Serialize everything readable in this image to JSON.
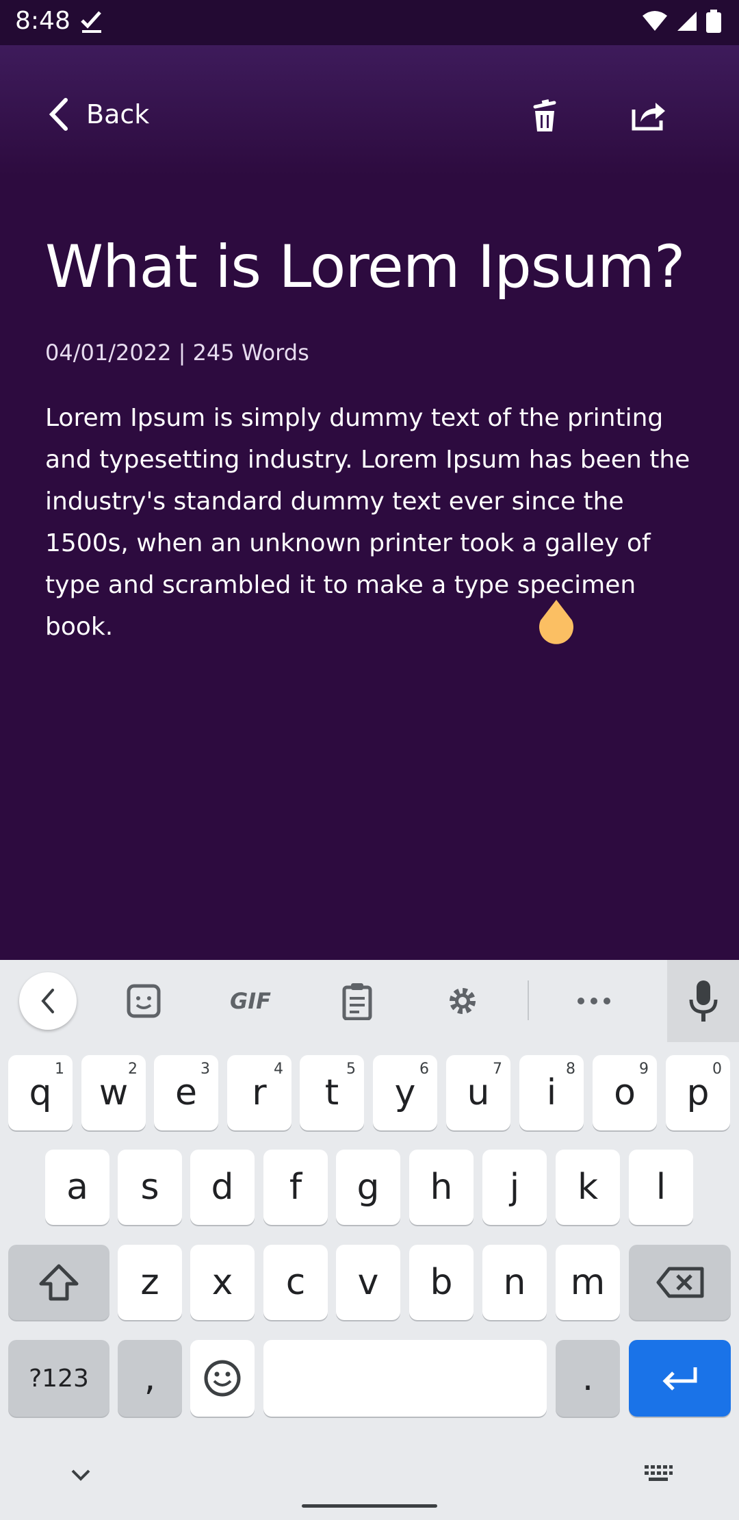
{
  "status": {
    "time": "8:48"
  },
  "header": {
    "back_label": "Back"
  },
  "note": {
    "title": "What is Lorem Ipsum?",
    "meta": "04/01/2022 | 245 Words",
    "body": "Lorem Ipsum is simply dummy text of the printing and typesetting industry. Lorem Ipsum has been the industry's standard dummy text ever since the 1500s, when an unknown printer took a galley of type and scrambled it to make a type specimen book."
  },
  "keyboard": {
    "toolbar": {
      "gif_label": "GIF"
    },
    "row1": [
      {
        "k": "q",
        "h": "1"
      },
      {
        "k": "w",
        "h": "2"
      },
      {
        "k": "e",
        "h": "3"
      },
      {
        "k": "r",
        "h": "4"
      },
      {
        "k": "t",
        "h": "5"
      },
      {
        "k": "y",
        "h": "6"
      },
      {
        "k": "u",
        "h": "7"
      },
      {
        "k": "i",
        "h": "8"
      },
      {
        "k": "o",
        "h": "9"
      },
      {
        "k": "p",
        "h": "0"
      }
    ],
    "row2": [
      "a",
      "s",
      "d",
      "f",
      "g",
      "h",
      "j",
      "k",
      "l"
    ],
    "row3": [
      "z",
      "x",
      "c",
      "v",
      "b",
      "n",
      "m"
    ],
    "symbols_label": "?123",
    "comma_label": ",",
    "period_label": "."
  },
  "colors": {
    "background": "#2d0b3f",
    "accent_enter": "#1a73e8",
    "cursor_handle": "#fbbf63"
  }
}
